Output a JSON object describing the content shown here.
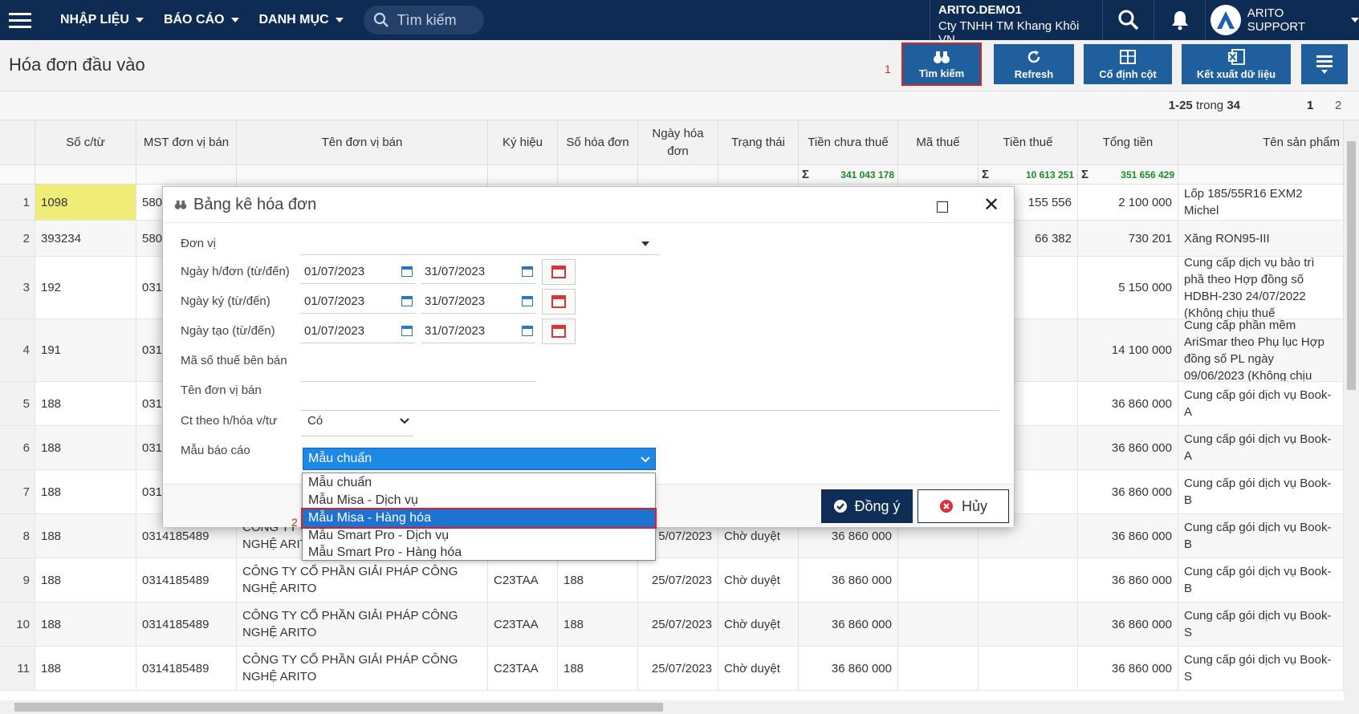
{
  "topbar": {
    "nav": [
      "NHẬP LIỆU",
      "BÁO CÁO",
      "DANH MỤC"
    ],
    "search_placeholder": "Tìm kiếm",
    "company_code": "ARITO.DEMO1",
    "company_name": "Cty TNHH TM Khang Khôi VN",
    "user_name": "ARITO SUPPORT"
  },
  "page": {
    "title": "Hóa đơn đầu vào",
    "toolbar": {
      "search": "Tìm kiếm",
      "refresh": "Refresh",
      "freeze": "Cố định cột",
      "export": "Kết xuất dữ liệu"
    },
    "step_markers": [
      "1",
      "2"
    ]
  },
  "pager": {
    "range": "1-25",
    "of": "trong",
    "total": "34",
    "pages": [
      "1",
      "2"
    ]
  },
  "grid": {
    "columns": [
      "Số c/từ",
      "MST đơn vị bán",
      "Tên đơn vị bán",
      "Ký hiệu",
      "Số hóa đơn",
      "Ngày hóa đơn",
      "Trạng thái",
      "Tiền chưa thuế",
      "Mã thuế",
      "Tiền thuế",
      "Tổng tiền",
      "Tên sản phẩm"
    ],
    "sums": {
      "pre_tax": "341 043 178",
      "tax": "10 613 251",
      "total": "351 656 429"
    },
    "rows": [
      {
        "idx": "1",
        "doc": "1098",
        "mst": "580",
        "name": "",
        "sign": "",
        "inv": "",
        "date": "",
        "status": "",
        "pre": "",
        "taxcode": "",
        "tax": "155 556",
        "total": "2 100 000",
        "product": "Lốp 185/55R16  EXM2 Michel"
      },
      {
        "idx": "2",
        "doc": "393234",
        "mst": "580",
        "name": "",
        "sign": "",
        "inv": "",
        "date": "",
        "status": "",
        "pre": "",
        "taxcode": "",
        "tax": "66 382",
        "total": "730 201",
        "product": "Xăng RON95-III"
      },
      {
        "idx": "3",
        "doc": "192",
        "mst": "031",
        "name": "",
        "sign": "",
        "inv": "",
        "date": "",
        "status": "",
        "pre": "",
        "taxcode": "",
        "tax": "",
        "total": "5 150 000",
        "product": "Cung cấp dịch vụ bảo trì phầ theo Hợp đồng số HDBH-230 24/07/2022 (Không chịu thuế"
      },
      {
        "idx": "4",
        "doc": "191",
        "mst": "031",
        "name": "",
        "sign": "",
        "inv": "",
        "date": "",
        "status": "",
        "pre": "",
        "taxcode": "",
        "tax": "",
        "total": "14 100 000",
        "product": "Cung cấp phần mềm AriSmar theo Phụ lục Hợp đồng số PL ngày 09/06/2023 (Không chịu"
      },
      {
        "idx": "5",
        "doc": "188",
        "mst": "031",
        "name": "",
        "sign": "",
        "inv": "",
        "date": "",
        "status": "",
        "pre": "",
        "taxcode": "",
        "tax": "",
        "total": "36 860 000",
        "product": "Cung cấp gói dịch vụ Book-A"
      },
      {
        "idx": "6",
        "doc": "188",
        "mst": "031",
        "name": "",
        "sign": "",
        "inv": "",
        "date": "",
        "status": "",
        "pre": "",
        "taxcode": "",
        "tax": "",
        "total": "36 860 000",
        "product": "Cung cấp gói dịch vụ Book-A"
      },
      {
        "idx": "7",
        "doc": "188",
        "mst": "031",
        "name": "",
        "sign": "",
        "inv": "",
        "date": "",
        "status": "",
        "pre": "",
        "taxcode": "",
        "tax": "",
        "total": "36 860 000",
        "product": "Cung cấp gói dịch vụ Book-B"
      },
      {
        "idx": "8",
        "doc": "188",
        "mst": "0314185489",
        "name": "CÔNG TY CỔ PHẦN GIẢI PHÁP CÔNG NGHỆ ARITO",
        "sign": "",
        "inv": "",
        "date": "5/07/2023",
        "status": "Chờ duyệt",
        "pre": "36 860 000",
        "taxcode": "",
        "tax": "",
        "total": "36 860 000",
        "product": "Cung cấp gói dịch vụ Book-B"
      },
      {
        "idx": "9",
        "doc": "188",
        "mst": "0314185489",
        "name": "CÔNG TY CỔ PHẦN GIẢI PHÁP CÔNG NGHỆ ARITO",
        "sign": "C23TAA",
        "inv": "188",
        "date": "25/07/2023",
        "status": "Chờ duyệt",
        "pre": "36 860 000",
        "taxcode": "",
        "tax": "",
        "total": "36 860 000",
        "product": "Cung cấp gói dịch vụ Book-B"
      },
      {
        "idx": "10",
        "doc": "188",
        "mst": "0314185489",
        "name": "CÔNG TY CỔ PHẦN GIẢI PHÁP CÔNG NGHỆ ARITO",
        "sign": "C23TAA",
        "inv": "188",
        "date": "25/07/2023",
        "status": "Chờ duyệt",
        "pre": "36 860 000",
        "taxcode": "",
        "tax": "",
        "total": "36 860 000",
        "product": "Cung cấp gói dịch vụ Book-S"
      },
      {
        "idx": "11",
        "doc": "188",
        "mst": "0314185489",
        "name": "CÔNG TY CỔ PHẦN GIẢI PHÁP CÔNG NGHỆ ARITO",
        "sign": "C23TAA",
        "inv": "188",
        "date": "25/07/2023",
        "status": "Chờ duyệt",
        "pre": "36 860 000",
        "taxcode": "",
        "tax": "",
        "total": "36 860 000",
        "product": "Cung cấp gói dịch vụ Book-S"
      }
    ]
  },
  "dialog": {
    "title": "Bảng kê hóa đơn",
    "fields": {
      "unit": "Đơn vị",
      "inv_date": "Ngày h/đơn (từ/đến)",
      "sign_date": "Ngày ký (từ/đến)",
      "create_date": "Ngày tạo (từ/đến)",
      "tax_id": "Mã số thuế bên bán",
      "seller": "Tên đơn vị bán",
      "by_doc": "Ct theo h/hóa v/tư",
      "template": "Mẫu báo cáo"
    },
    "date_from": "01/07/2023",
    "date_to": "31/07/2023",
    "by_doc_value": "Có",
    "template_value": "Mẫu chuẩn",
    "template_options": [
      "Mẫu chuẩn",
      "Mẫu Misa - Dịch vụ",
      "Mẫu Misa - Hàng hóa",
      "Mẫu Smart Pro - Dịch vụ",
      "Mẫu Smart Pro - Hàng hóa"
    ],
    "selected_option_index": 2,
    "ok": "Đồng ý",
    "cancel": "Hủy"
  }
}
